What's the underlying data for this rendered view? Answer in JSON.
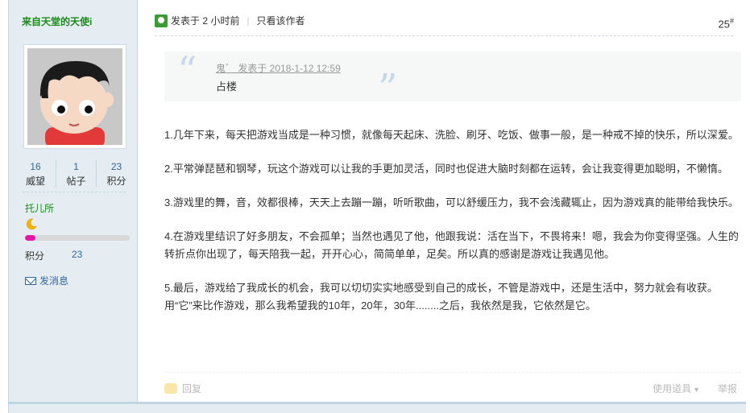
{
  "author": {
    "name": "来自天堂的天使i",
    "stats": [
      {
        "value": "16",
        "label": "威望"
      },
      {
        "value": "1",
        "label": "帖子"
      },
      {
        "value": "23",
        "label": "积分"
      }
    ],
    "group": "托儿所",
    "level_progress": 0.1,
    "credit_label": "积分",
    "credit_value": "23",
    "message_label": "发消息"
  },
  "post": {
    "posted_label": "发表于 2 小时前",
    "only_author_label": "只看该作者",
    "floor": "25",
    "floor_mark": "#",
    "quote": {
      "meta": "鬼゛ 发表于 2018-1-12 12:59",
      "text": "占楼"
    },
    "paragraphs": [
      "1.几年下来，每天把游戏当成是一种习惯，就像每天起床、洗脸、刷牙、吃饭、做事一般，是一种戒不掉的快乐，所以深爱。",
      "2.平常弹琵琶和钢琴，玩这个游戏可以让我的手更加灵活，同时也促进大脑时刻都在运转，会让我变得更加聪明，不懒惰。",
      "3.游戏里的舞，音，效都很棒，天天上去蹦一蹦，听听歌曲，可以舒缓压力，我不会浅藏辄止，因为游戏真的能带给我快乐。",
      "4.在游戏里结识了好多朋友，不会孤单；当然也遇见了他，他跟我说：活在当下，不畏将来！嗯，我会为你变得坚强。人生的转折点你出现了，每天陪我一起，开开心心，简简单单，足矣。所以真的感谢是游戏让我遇见他。",
      "5.最后，游戏给了我成长的机会，我可以切切实实地感受到自己的成长，不管是游戏中，还是生活中，努力就会有收获。用“它”来比作游戏，那么我希望我的10年，20年，30年........之后，我依然是我，它依然是它。"
    ],
    "reply_label": "回复",
    "tools_label": "使用道具",
    "report_label": "举报"
  },
  "colors": {
    "sidebar_bg": "#e5edf2",
    "border": "#c2d5e3",
    "author_green": "#1a8a1a",
    "link_blue": "#336699",
    "level_bar": "#e11ba6"
  }
}
